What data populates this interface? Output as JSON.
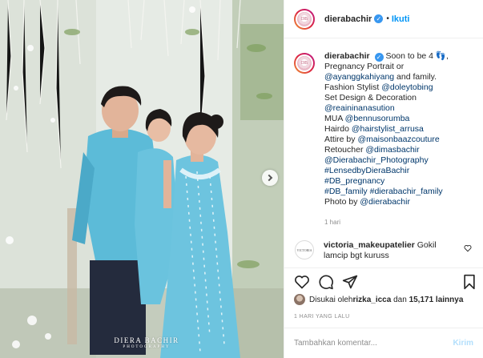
{
  "post": {
    "username": "dierabachir",
    "follow_label": "Ikuti",
    "dot": "•",
    "verified_glyph": "✓",
    "avatar_text": "DB",
    "caption": {
      "username": "dierabachir",
      "text_lines": [
        "Soon to be 4 👣,",
        "Pregnancy Portrait or"
      ],
      "inline_mention": "@ayanggkahiyang",
      "inline_after": " and family.",
      "stylist_prefix": "Fashion Stylist ",
      "stylist_link": "@doleytobing",
      "set_design_label": "Set Design & Decoration",
      "set_design_link": "@reaininanasution",
      "mua_prefix": "MUA ",
      "mua_link": "@bennusorumba",
      "hairdo_prefix": "Hairdo ",
      "hairdo_link": "@hairstylist_arrusa",
      "attire_prefix": "Attire by ",
      "attire_link": "@maisonbaazcouture",
      "retoucher_prefix": "Retoucher ",
      "retoucher_link": "@dimasbachir",
      "links": [
        "@Dierabachir_Photography",
        "#LensedbyDieraBachir",
        "#DB_pregnancy",
        "#DB_family #dierabachir_family"
      ],
      "photo_prefix": "Photo by ",
      "photo_link": "@dierabachir",
      "time": "1 hari"
    },
    "comment": {
      "avatar_text": "VICTORIA",
      "username": "victoria_makeupatelier",
      "text": "Gokil lamcip bgt kuruss"
    },
    "likes": {
      "prefix": "Disukai oleh ",
      "user": "rizka_icca",
      "mid": " dan ",
      "count": "15,171 lainnya"
    },
    "timestamp": "1 HARI YANG LALU",
    "comment_input": {
      "placeholder": "Tambahkan komentar...",
      "post_label": "Kirim"
    },
    "watermark": {
      "main": "DIERA BACHIR",
      "sub": "PHOTOGRAPHY"
    }
  },
  "colors": {
    "link": "#00376b",
    "accent": "#0095f6",
    "muted": "#8e8e8e",
    "outfit": "#5bb8d6"
  },
  "icons": [
    "heart-icon",
    "comment-icon",
    "share-icon",
    "bookmark-icon",
    "verified-icon",
    "chevron-right-icon"
  ]
}
